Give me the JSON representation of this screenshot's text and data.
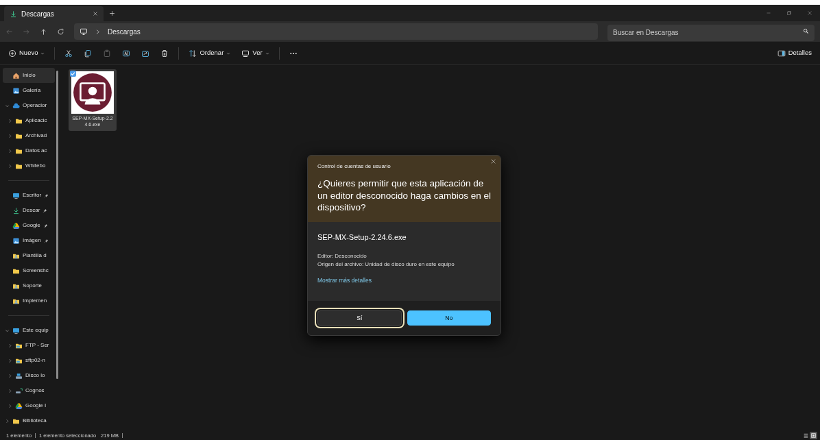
{
  "tabs": [
    {
      "label": "Descargas",
      "selected": true
    }
  ],
  "nav_buttons": [
    {
      "kind": "back",
      "disabled": true
    },
    {
      "kind": "forward",
      "disabled": true
    },
    {
      "kind": "up",
      "disabled": false
    },
    {
      "kind": "refresh",
      "disabled": false
    }
  ],
  "address_bar": {
    "path": [
      "Descargas"
    ]
  },
  "search": {
    "placeholder": "Buscar en Descargas"
  },
  "toolbar": {
    "items": [
      {
        "kind": "new",
        "label": "Nuevo",
        "disabled": false
      },
      {
        "kind": "cut",
        "disabled": false
      },
      {
        "kind": "copy",
        "disabled": false
      },
      {
        "kind": "paste",
        "disabled": true
      },
      {
        "kind": "rename",
        "disabled": false
      },
      {
        "kind": "share",
        "disabled": false
      },
      {
        "kind": "delete",
        "disabled": false
      },
      {
        "kind": "sort",
        "label": "Ordenar",
        "disabled": false
      },
      {
        "kind": "view",
        "label": "Ver",
        "disabled": false
      },
      {
        "kind": "more",
        "disabled": false
      }
    ],
    "details": {
      "label": "Detalles"
    }
  },
  "sidebar": {
    "groups": [
      [
        {
          "label": "Inicio",
          "kind": "home",
          "selected": true
        },
        {
          "label": "Galería",
          "kind": "gallery",
          "selected": false
        },
        {
          "label": "Operacior",
          "kind": "cloud",
          "selected": false,
          "expanded": true,
          "children": [
            {
              "label": "Aplicacic",
              "kind": "folder",
              "selected": false,
              "expanded": false
            },
            {
              "label": "Archivad",
              "kind": "folder",
              "selected": false,
              "expanded": false
            },
            {
              "label": "Datos ac",
              "kind": "folder",
              "selected": false,
              "expanded": false
            },
            {
              "label": "Whitebo",
              "kind": "folder",
              "selected": false,
              "expanded": false
            }
          ]
        }
      ],
      [
        {
          "label": "Escritor",
          "kind": "desktop",
          "selected": false,
          "pinned": true
        },
        {
          "label": "Descar",
          "kind": "download",
          "selected": false,
          "pinned": true
        },
        {
          "label": "Google",
          "kind": "drive",
          "selected": false,
          "pinned": true
        },
        {
          "label": "Imágen",
          "kind": "gallery",
          "selected": false,
          "pinned": true
        },
        {
          "label": "Plantilla d",
          "kind": "userfolder",
          "selected": false,
          "pinned": false
        },
        {
          "label": "Screenshc",
          "kind": "folder",
          "selected": false,
          "pinned": false
        },
        {
          "label": "Soporte",
          "kind": "userfolder",
          "selected": false,
          "pinned": false
        },
        {
          "label": "Implemen",
          "kind": "userfolder",
          "selected": false,
          "pinned": false
        }
      ],
      [
        {
          "label": "Este equip",
          "kind": "desktop",
          "selected": false,
          "expanded": true,
          "children": [
            {
              "label": "FTP - Ser",
              "kind": "netfolder",
              "selected": false,
              "expanded": false
            },
            {
              "label": "sftp02-n",
              "kind": "netfolder",
              "selected": false,
              "expanded": false
            },
            {
              "label": "Disco lo",
              "kind": "disk",
              "selected": false,
              "expanded": false
            },
            {
              "label": "Cognos",
              "kind": "netdrive",
              "selected": false,
              "expanded": false
            },
            {
              "label": "Google I",
              "kind": "drive",
              "selected": false,
              "expanded": false
            }
          ]
        },
        {
          "label": "Biblioteca",
          "kind": "folder",
          "selected": false,
          "expanded": false
        }
      ]
    ]
  },
  "files": [
    {
      "name": "SEP-MX-Setup-2.24.6.exe",
      "selected": true,
      "checked": true
    }
  ],
  "dialog": {
    "caption": "Control de cuentas de usuario",
    "question": "¿Quieres permitir que esta aplicación de un editor desconocido haga cambios en el dispositivo?",
    "program": "SEP-MX-Setup-2.24.6.exe",
    "details": [
      "Editor: Desconocido",
      "Origen del archivo: Unidad de disco duro en este equipo"
    ],
    "more_link": "Mostrar más detalles",
    "buttons": [
      {
        "label": "Sí",
        "kind": "secondary",
        "focused": true
      },
      {
        "label": "No",
        "kind": "primary",
        "focused": false
      }
    ]
  },
  "status_bar": {
    "items": [
      "1 elemento",
      "1 elemento seleccionado",
      "219 MB"
    ],
    "views": [
      {
        "kind": "details",
        "selected": false
      },
      {
        "kind": "tiles",
        "selected": true
      }
    ]
  }
}
